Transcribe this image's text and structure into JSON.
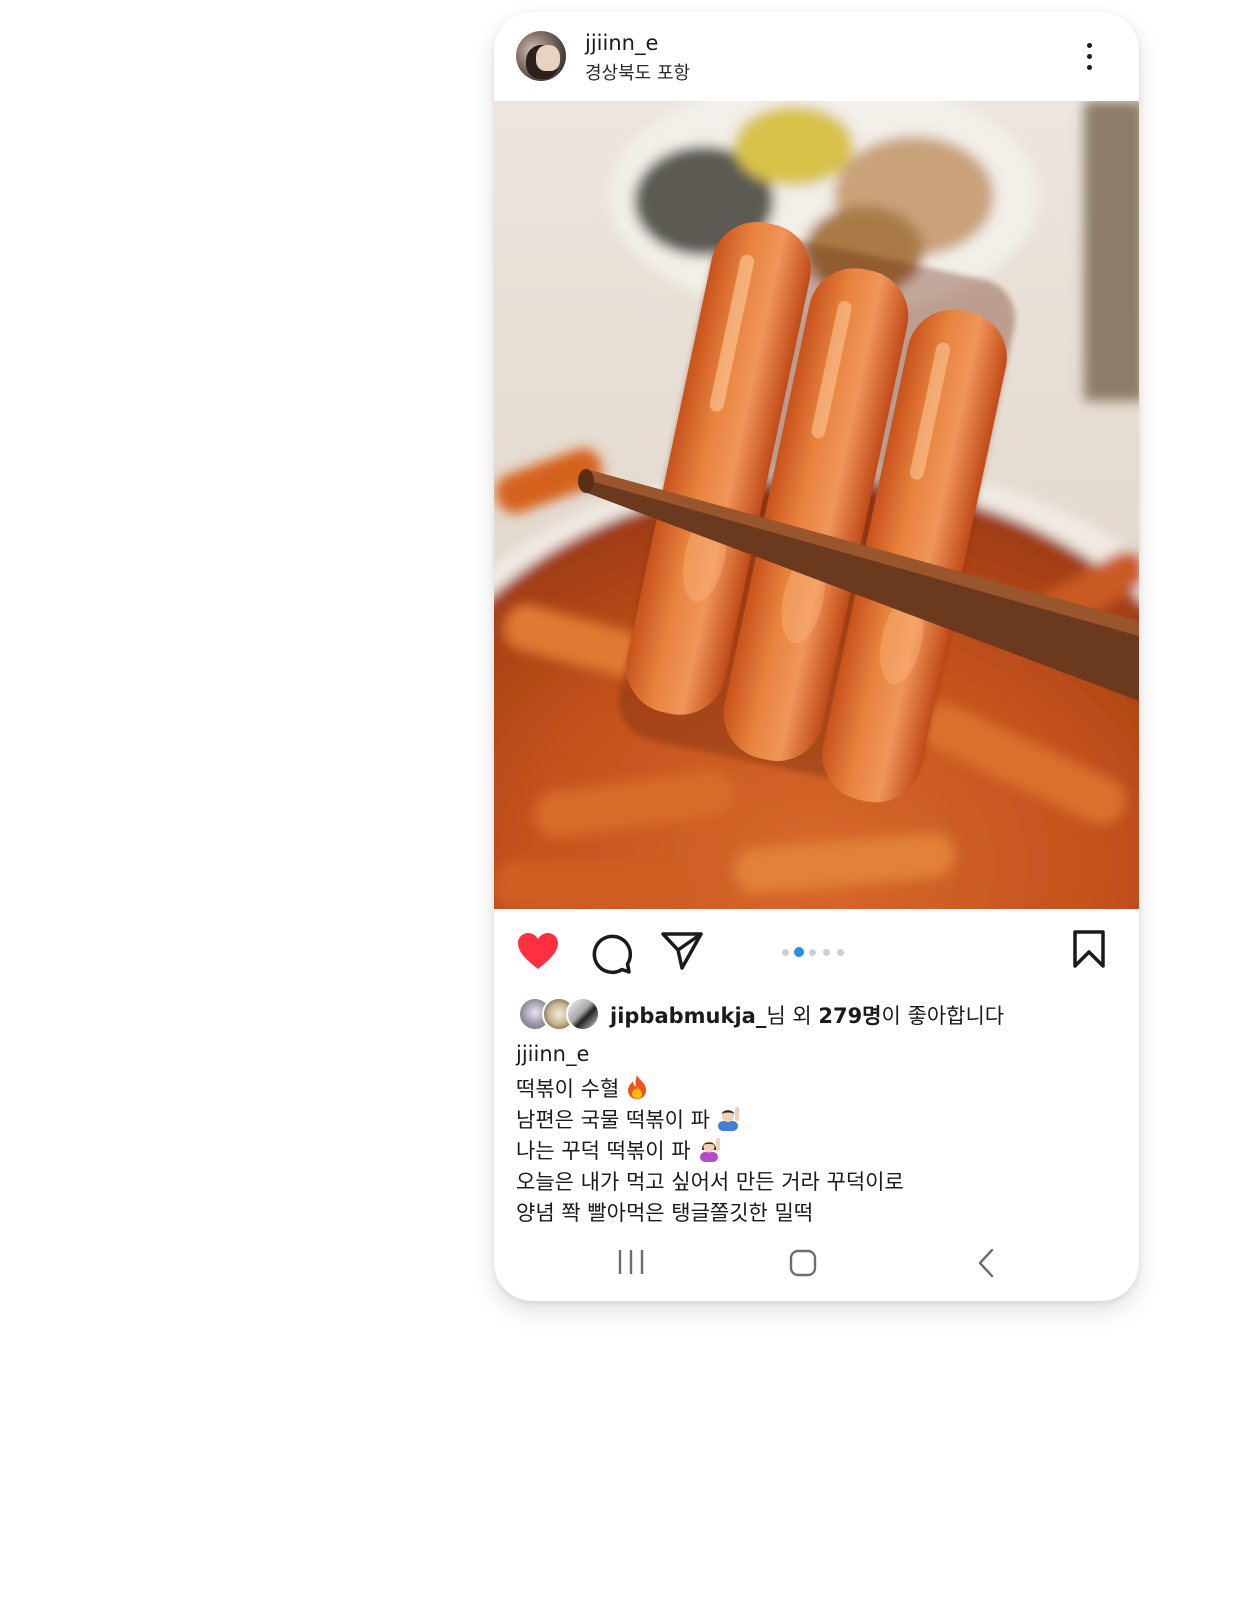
{
  "post": {
    "username": "jjiinn_e",
    "location": "경상북도 포항",
    "carousel": {
      "count": 5,
      "active_index": 1
    },
    "liked": true,
    "likes": {
      "first_liker": "jipbabmukja_",
      "suffix_nim": "님 외 ",
      "count_text": "279명",
      "suffix_end": "이 좋아합니다"
    },
    "caption": {
      "username": "jjiinn_e",
      "lines": [
        "떡볶이 수혈",
        "남편은 국물 떡볶이 파",
        "나는 꾸덕 떡볶이 파",
        "오늘은 내가 먹고 싶어서 만든 거라 꾸덕이로",
        "양념 쫙 빨아먹은 탱글쫄깃한 밀떡"
      ],
      "line_icons": [
        "fire-icon",
        "man-raising-hand-icon",
        "woman-raising-hand-icon",
        "",
        ""
      ]
    }
  },
  "colors": {
    "like_red": "#ff3040",
    "carousel_active": "#2b8fe0",
    "carousel_inactive": "#cfcfcf"
  },
  "icons": {
    "more": "more-vertical-icon",
    "like": "heart-icon",
    "comment": "comment-icon",
    "share": "send-icon",
    "save": "bookmark-icon",
    "nav_recents": "recent-apps-icon",
    "nav_home": "home-icon",
    "nav_back": "back-icon"
  }
}
